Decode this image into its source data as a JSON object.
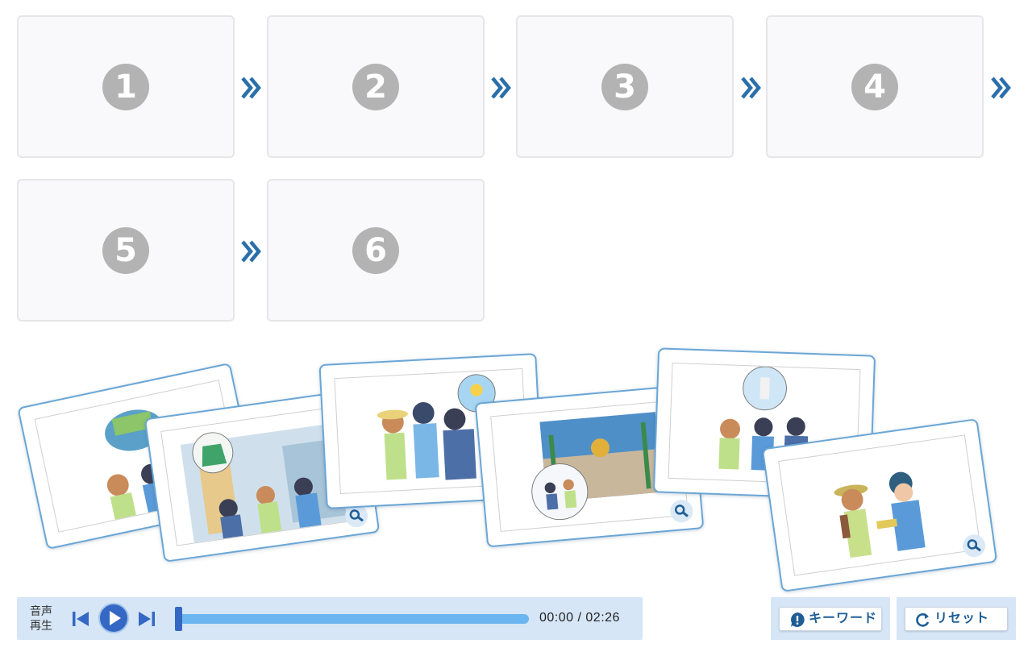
{
  "slots": [
    "1",
    "2",
    "3",
    "4",
    "5",
    "6"
  ],
  "player": {
    "label_line1": "音声",
    "label_line2": "再生",
    "current_time": "00:00",
    "separator": "/",
    "total_time": "02:26",
    "progress": 0.0
  },
  "buttons": {
    "keyword": "キーワード",
    "reset": "リセット"
  },
  "colors": {
    "accent": "#2a6faa",
    "card_border": "#6aa6d6",
    "track": "#6bb5f0",
    "panel": "#d6e6f6",
    "slot_number": "#b3b3b3"
  },
  "icons": [
    "chevron-double-right-icon",
    "previous-track-icon",
    "play-icon",
    "next-track-icon",
    "search-zoom-icon",
    "exclamation-icon",
    "reset-icon"
  ]
}
